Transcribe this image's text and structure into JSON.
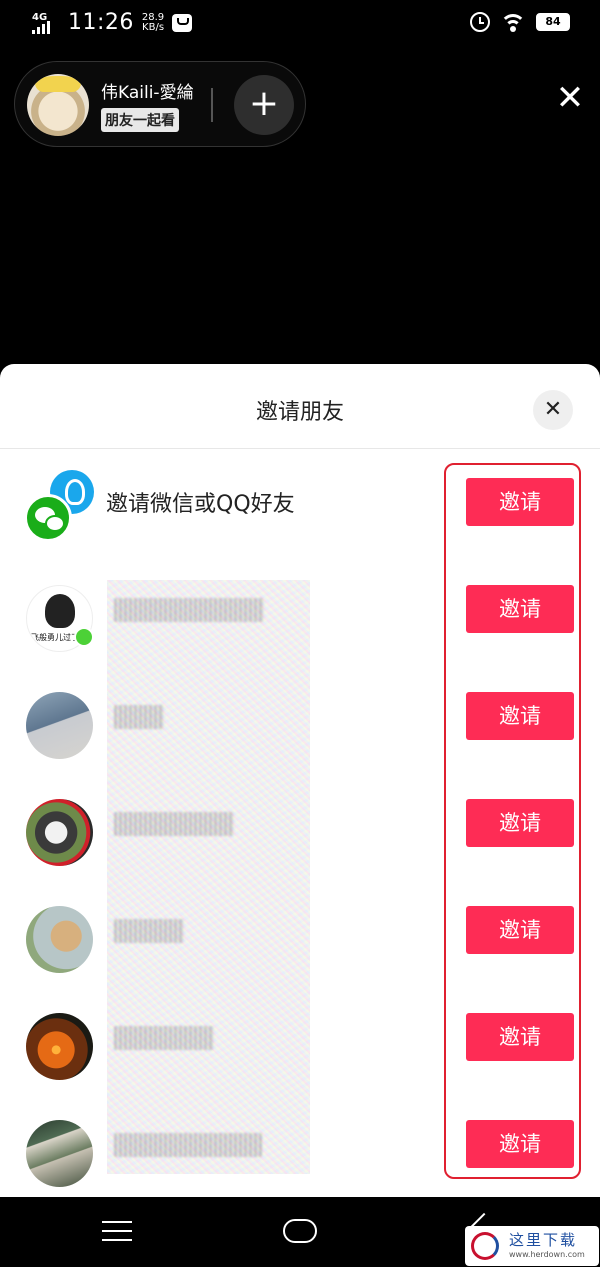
{
  "status_bar": {
    "network": "4G",
    "time": "11:26",
    "speed_value": "28.9",
    "speed_unit": "KB/s",
    "battery": "84"
  },
  "host": {
    "name": "伟Kaili-愛綸",
    "tag": "朋友一起看",
    "add_icon": "+",
    "close_icon": "✕"
  },
  "sheet": {
    "title": "邀请朋友",
    "close_icon": "✕"
  },
  "social_invite": {
    "label": "邀请微信或QQ好友",
    "button": "邀请"
  },
  "friends": [
    {
      "button": "邀请"
    },
    {
      "button": "邀请"
    },
    {
      "button": "邀请"
    },
    {
      "button": "邀请"
    },
    {
      "button": "邀请"
    },
    {
      "button": "邀请"
    }
  ],
  "watermark": {
    "text": "这里下载",
    "url": "www.herdown.com"
  },
  "colors": {
    "accent": "#fe2c55",
    "highlight_frame": "#e02030",
    "wechat": "#1aad19",
    "qq": "#1aa7ec"
  }
}
